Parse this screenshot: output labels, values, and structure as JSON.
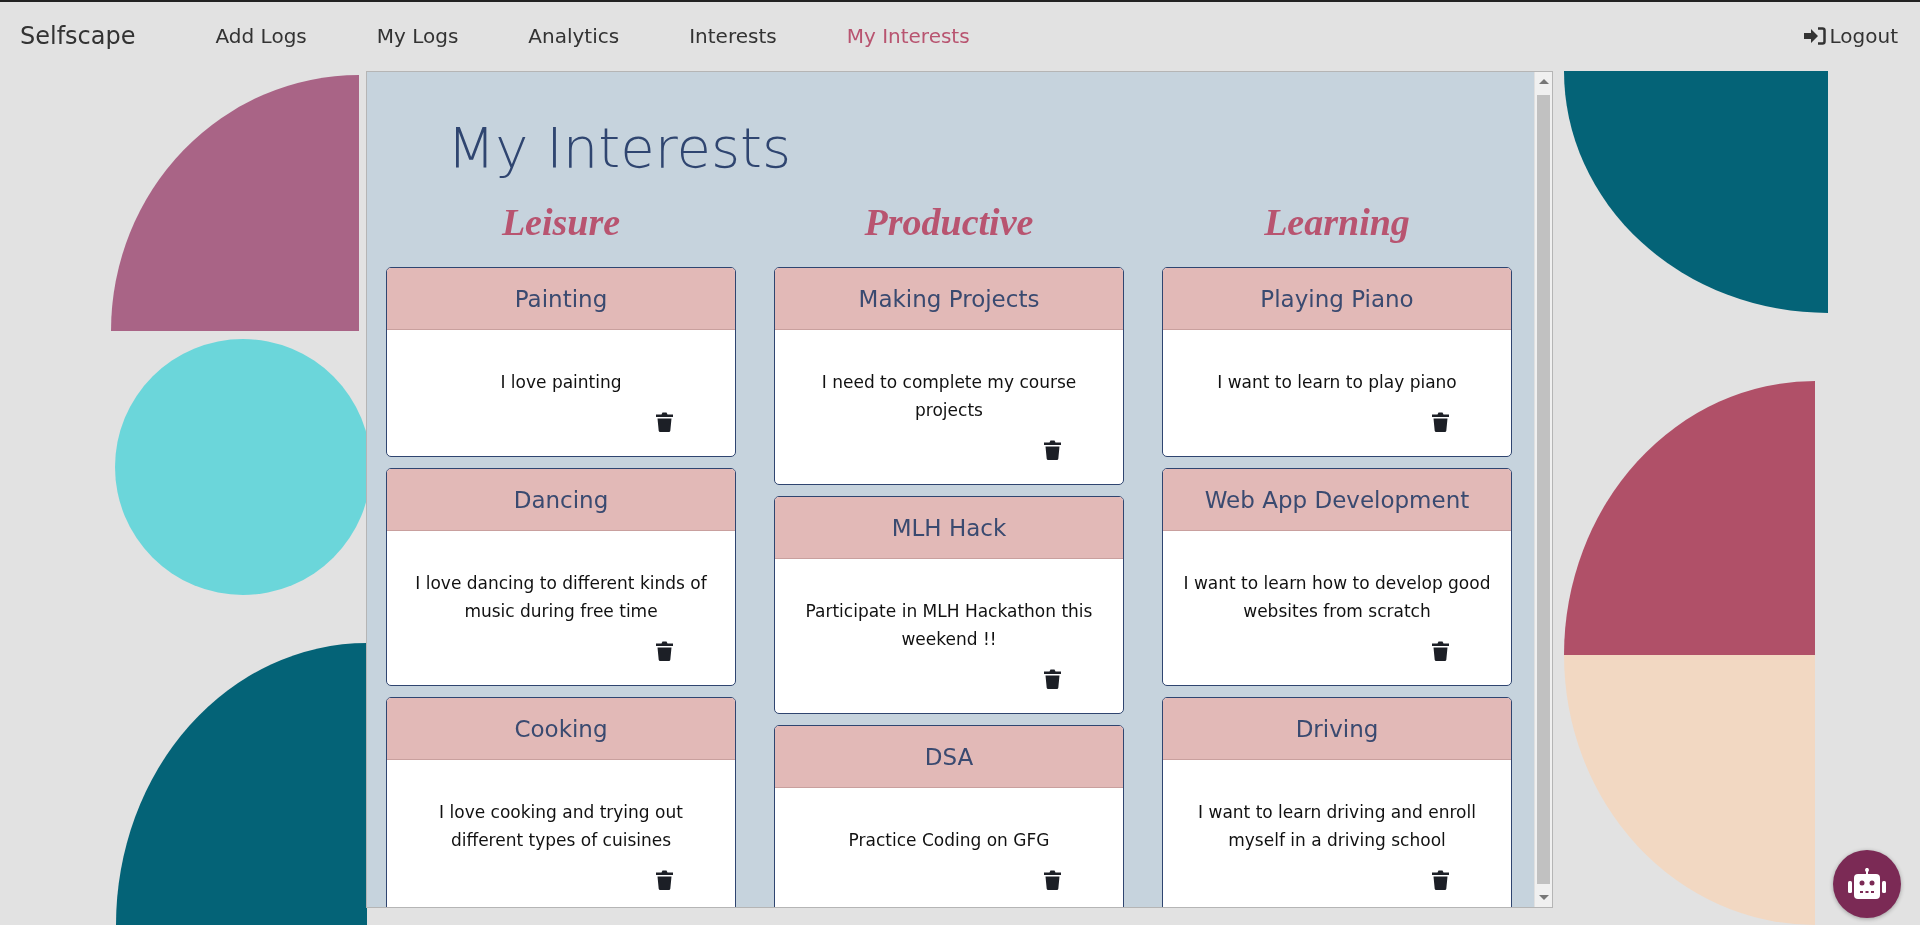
{
  "brand": "Selfscape",
  "nav": [
    {
      "label": "Add Logs",
      "selected": false
    },
    {
      "label": "My Logs",
      "selected": false
    },
    {
      "label": "Analytics",
      "selected": false
    },
    {
      "label": "Interests",
      "selected": false
    },
    {
      "label": "My Interests",
      "selected": true
    }
  ],
  "logout": {
    "label": "Logout"
  },
  "page": {
    "title": "My Interests"
  },
  "columns": [
    {
      "title": "Leisure",
      "cards": [
        {
          "title": "Painting",
          "text": "I love painting"
        },
        {
          "title": "Dancing",
          "text": "I love dancing to different kinds of music during free time"
        },
        {
          "title": "Cooking",
          "text": "I love cooking and trying out different types of cuisines"
        }
      ]
    },
    {
      "title": "Productive",
      "cards": [
        {
          "title": "Making Projects",
          "text": "I need to complete my course projects"
        },
        {
          "title": "MLH Hack",
          "text": "Participate in MLH Hackathon this weekend !!"
        },
        {
          "title": "DSA",
          "text": "Practice Coding on GFG"
        }
      ]
    },
    {
      "title": "Learning",
      "cards": [
        {
          "title": "Playing Piano",
          "text": "I want to learn to play piano"
        },
        {
          "title": "Web App Development",
          "text": "I want to learn how to develop good websites from scratch"
        },
        {
          "title": "Driving",
          "text": "I want to learn driving and enroll myself in a driving school"
        }
      ]
    }
  ]
}
